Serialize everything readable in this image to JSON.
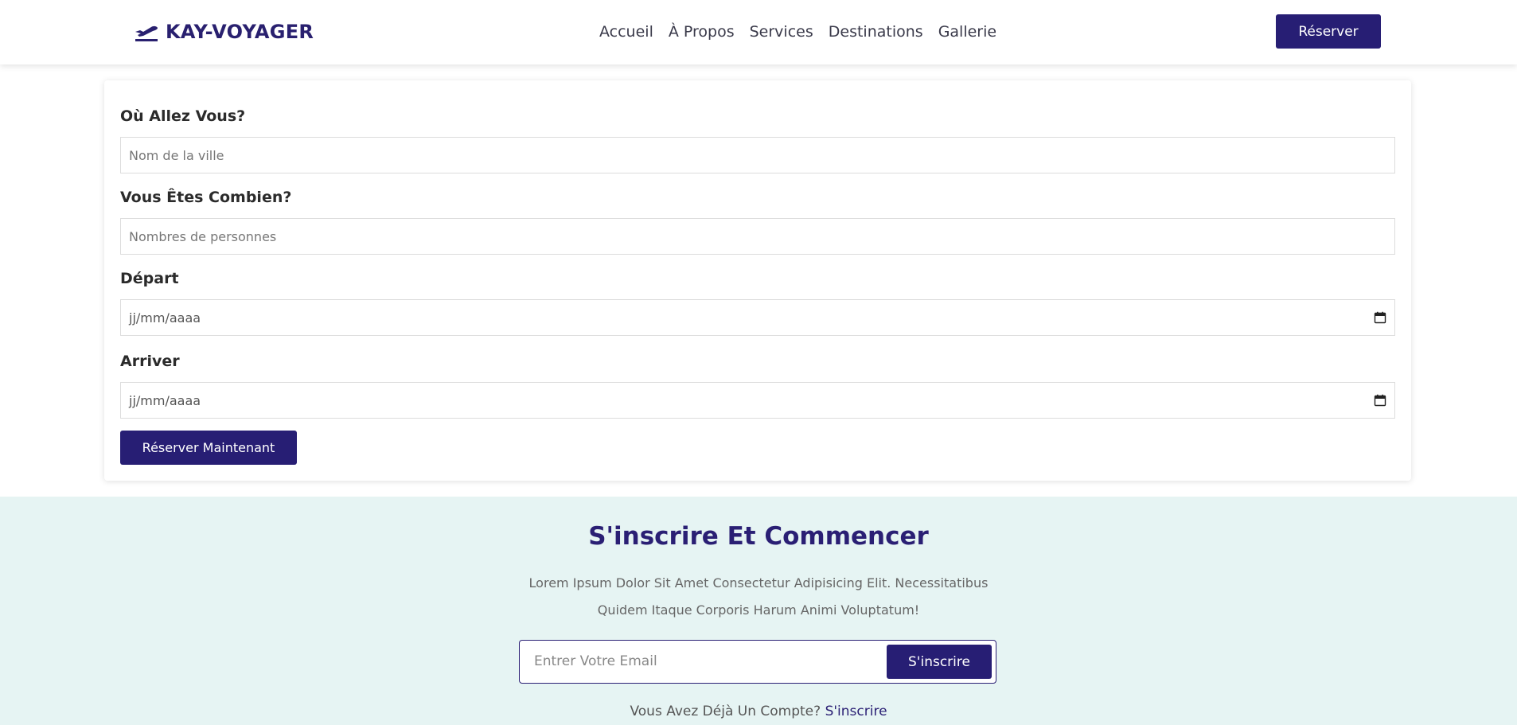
{
  "header": {
    "brand": "KAY-VOYAGER",
    "logo_icon": "airplane-takeoff-icon",
    "nav": [
      "Accueil",
      "À Propos",
      "Services",
      "Destinations",
      "Gallerie"
    ],
    "cta": "Réserver"
  },
  "booking": {
    "destination_label": "Où Allez Vous?",
    "destination_placeholder": "Nom de la ville",
    "people_label": "Vous Êtes Combien?",
    "people_placeholder": "Nombres de personnes",
    "departure_label": "Départ",
    "departure_placeholder": "jj/mm/aaaa",
    "arrival_label": "Arriver",
    "arrival_placeholder": "jj/mm/aaaa",
    "submit": "Réserver Maintenant"
  },
  "signup": {
    "title": "S'inscrire Et Commencer",
    "text_line1": "Lorem Ipsum Dolor Sit Amet Consectetur Adipisicing Elit. Necessitatibus",
    "text_line2": "Quidem Itaque Corporis Harum Animi Voluptatum!",
    "email_placeholder": "Entrer Votre Email",
    "button": "S'inscrire",
    "footer_text": "Vous Avez Déjà Un Compte?",
    "footer_link": "S'inscrire"
  },
  "colors": {
    "brand": "#271e74",
    "signup_bg": "#e6f4f3"
  }
}
